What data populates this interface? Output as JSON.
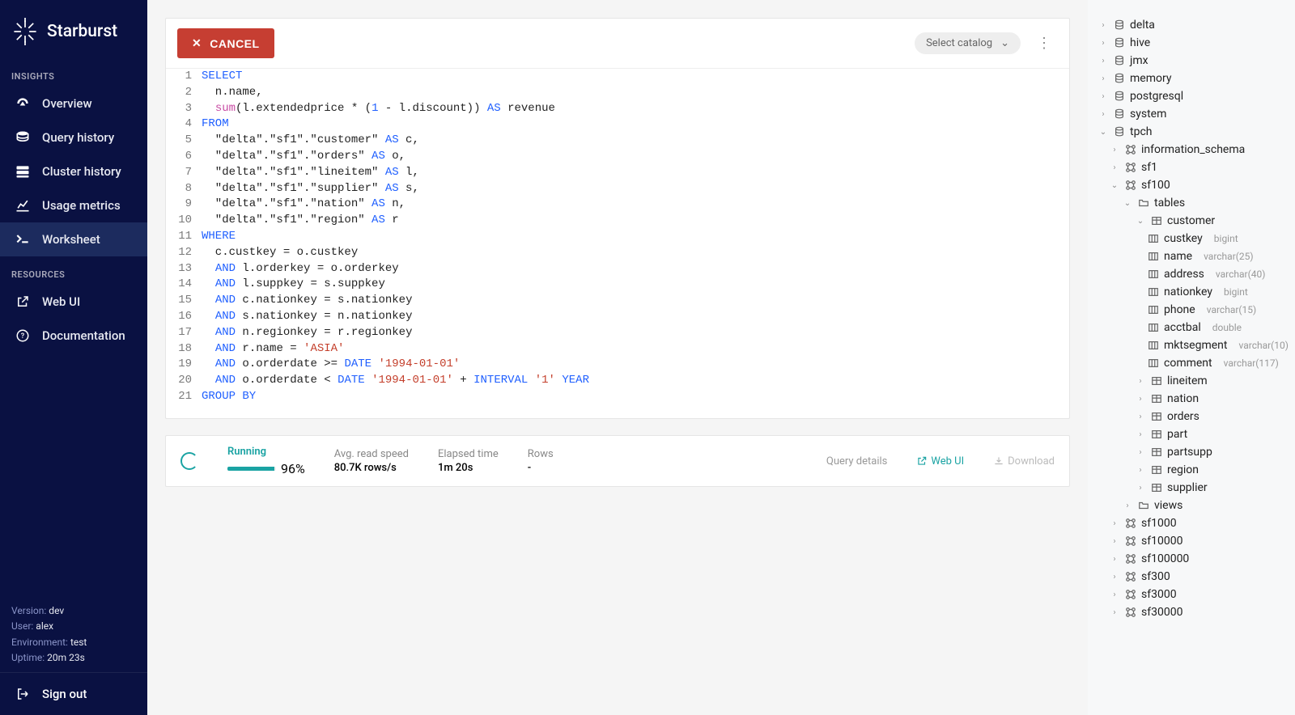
{
  "app": {
    "name": "Starburst"
  },
  "nav": {
    "section_insights": "INSIGHTS",
    "section_resources": "RESOURCES",
    "overview": "Overview",
    "query_history": "Query history",
    "cluster_history": "Cluster history",
    "usage_metrics": "Usage metrics",
    "worksheet": "Worksheet",
    "web_ui": "Web UI",
    "documentation": "Documentation",
    "sign_out": "Sign out"
  },
  "sysinfo": {
    "version_label": "Version:",
    "version": "dev",
    "user_label": "User:",
    "user": "alex",
    "env_label": "Environment:",
    "env": "test",
    "uptime_label": "Uptime:",
    "uptime": "20m 23s"
  },
  "toolbar": {
    "cancel": "CANCEL",
    "catalog_dd": "Select catalog"
  },
  "editor": {
    "lines": [
      {
        "n": 1,
        "html": "<span class='kw'>SELECT</span>"
      },
      {
        "n": 2,
        "html": "  n.name,"
      },
      {
        "n": 3,
        "html": "  <span class='fn'>sum</span>(l.extendedprice * (<span class='kw'>1</span> - l.discount)) <span class='kw'>AS</span> revenue"
      },
      {
        "n": 4,
        "html": "<span class='kw'>FROM</span>"
      },
      {
        "n": 5,
        "html": "  \"delta\".\"sf1\".\"customer\" <span class='kw'>AS</span> c,"
      },
      {
        "n": 6,
        "html": "  \"delta\".\"sf1\".\"orders\" <span class='kw'>AS</span> o,"
      },
      {
        "n": 7,
        "html": "  \"delta\".\"sf1\".\"lineitem\" <span class='kw'>AS</span> l,"
      },
      {
        "n": 8,
        "html": "  \"delta\".\"sf1\".\"supplier\" <span class='kw'>AS</span> s,"
      },
      {
        "n": 9,
        "html": "  \"delta\".\"sf1\".\"nation\" <span class='kw'>AS</span> n,"
      },
      {
        "n": 10,
        "html": "  \"delta\".\"sf1\".\"region\" <span class='kw'>AS</span> r"
      },
      {
        "n": 11,
        "html": "<span class='kw'>WHERE</span>"
      },
      {
        "n": 12,
        "html": "  c.custkey = o.custkey"
      },
      {
        "n": 13,
        "html": "  <span class='kw'>AND</span> l.orderkey = o.orderkey"
      },
      {
        "n": 14,
        "html": "  <span class='kw'>AND</span> l.suppkey = s.suppkey"
      },
      {
        "n": 15,
        "html": "  <span class='kw'>AND</span> c.nationkey = s.nationkey"
      },
      {
        "n": 16,
        "html": "  <span class='kw'>AND</span> s.nationkey = n.nationkey"
      },
      {
        "n": 17,
        "html": "  <span class='kw'>AND</span> n.regionkey = r.regionkey"
      },
      {
        "n": 18,
        "html": "  <span class='kw'>AND</span> r.name = <span class='str'>'ASIA'</span>"
      },
      {
        "n": 19,
        "html": "  <span class='kw'>AND</span> o.orderdate &gt;= <span class='kw'>DATE</span> <span class='str'>'1994-01-01'</span>"
      },
      {
        "n": 20,
        "html": "  <span class='kw'>AND</span> o.orderdate &lt; <span class='kw'>DATE</span> <span class='str'>'1994-01-01'</span> + <span class='kw'>INTERVAL</span> <span class='str'>'1'</span> <span class='kw'>YEAR</span>"
      },
      {
        "n": 21,
        "html": "<span class='kw'>GROUP BY</span>"
      }
    ]
  },
  "status": {
    "running_label": "Running",
    "percent": "96%",
    "percent_num": 96,
    "read_speed_label": "Avg. read speed",
    "read_speed": "80.7K rows/s",
    "elapsed_label": "Elapsed time",
    "elapsed": "1m 20s",
    "rows_label": "Rows",
    "rows": "-",
    "query_details": "Query details",
    "web_ui": "Web UI",
    "download": "Download"
  },
  "tree": {
    "catalogs": [
      "delta",
      "hive",
      "jmx",
      "memory",
      "postgresql",
      "system",
      "tpch"
    ],
    "tpch_schemas_closed": [
      "information_schema",
      "sf1"
    ],
    "tpch_schema_open": "sf100",
    "tables_folder": "tables",
    "open_table": "customer",
    "columns": [
      {
        "name": "custkey",
        "type": "bigint"
      },
      {
        "name": "name",
        "type": "varchar(25)"
      },
      {
        "name": "address",
        "type": "varchar(40)"
      },
      {
        "name": "nationkey",
        "type": "bigint"
      },
      {
        "name": "phone",
        "type": "varchar(15)"
      },
      {
        "name": "acctbal",
        "type": "double"
      },
      {
        "name": "mktsegment",
        "type": "varchar(10)"
      },
      {
        "name": "comment",
        "type": "varchar(117)"
      }
    ],
    "other_tables": [
      "lineitem",
      "nation",
      "orders",
      "part",
      "partsupp",
      "region",
      "supplier"
    ],
    "views_folder": "views",
    "tpch_schemas_tail": [
      "sf1000",
      "sf10000",
      "sf100000",
      "sf300",
      "sf3000",
      "sf30000"
    ]
  }
}
